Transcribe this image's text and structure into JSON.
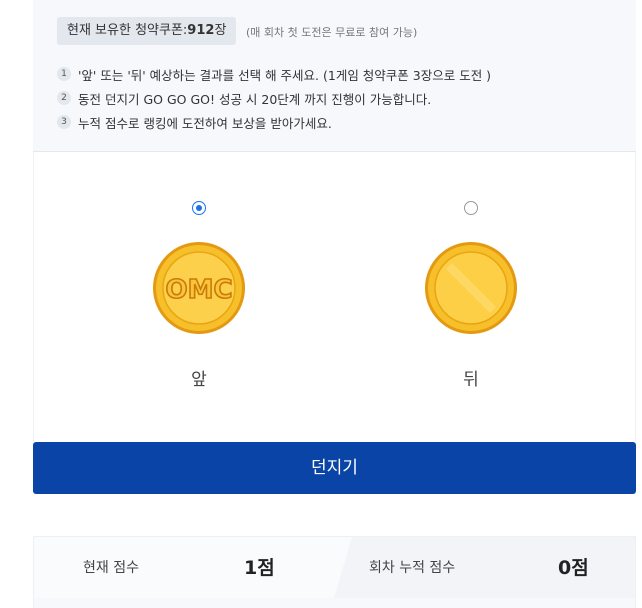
{
  "coupon": {
    "prefix": "현재 보유한 청약쿠폰:",
    "count": "912",
    "suffix": "장",
    "note": "(매 회차 첫 도전은 무료로 참여 가능)"
  },
  "rules": [
    {
      "num": "1",
      "text": "'앞' 또는 '뒤' 예상하는 결과를 선택 해 주세요. (1게임 청약쿠폰 3장으로 도전 )"
    },
    {
      "num": "2",
      "text": "동전 던지기 GO GO GO! 성공 시 20단계 까지 진행이 가능합니다."
    },
    {
      "num": "3",
      "text": "누적 점수로 랭킹에 도전하여 보상을 받아가세요."
    }
  ],
  "choices": {
    "front": {
      "label": "앞",
      "coin_text": "OMC",
      "selected": true
    },
    "back": {
      "label": "뒤",
      "selected": false
    }
  },
  "toss_button": "던지기",
  "score": {
    "current_label": "현재 점수",
    "current_value": "1점",
    "cumulative_label": "회차 누적 점수",
    "cumulative_value": "0점"
  },
  "colors": {
    "primary": "#0a44a6",
    "radio_selected": "#1a73e8",
    "coin_gold": "#f5b81c"
  },
  "icons": {
    "front_coin": "omc-coin-front-icon",
    "back_coin": "plain-coin-back-icon"
  }
}
